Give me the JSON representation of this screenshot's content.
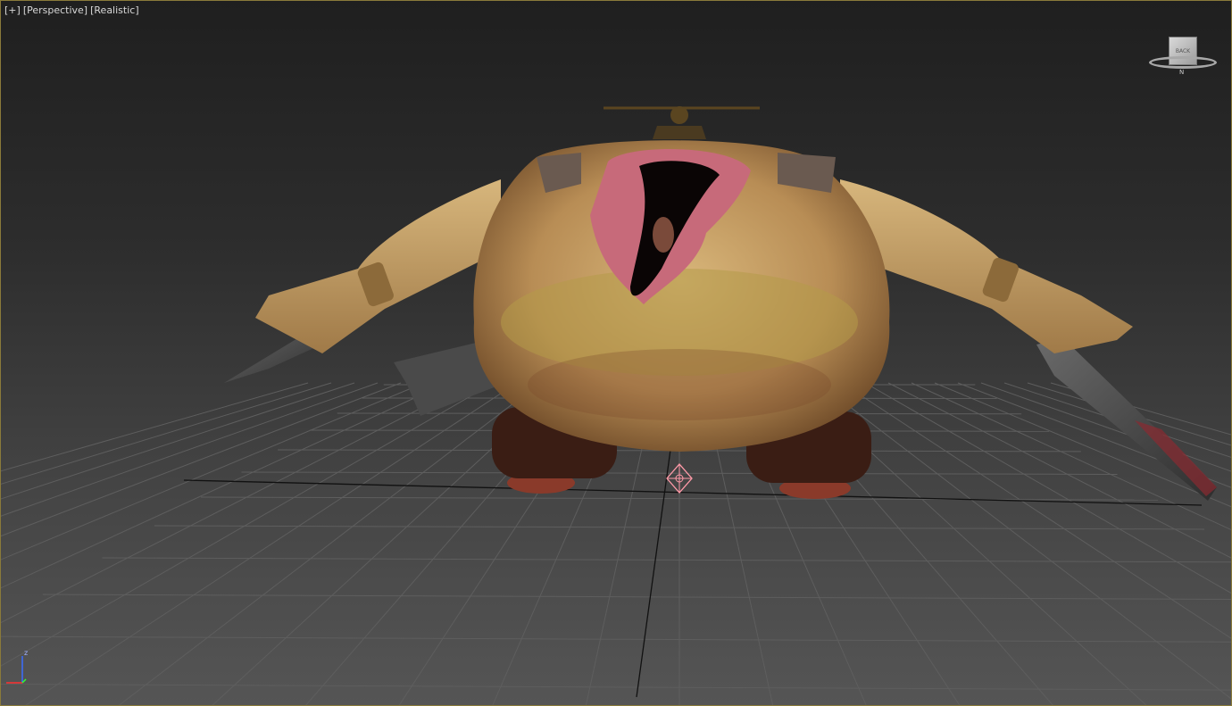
{
  "viewport": {
    "labels": [
      "[+]",
      "[Perspective]",
      "[Realistic]"
    ],
    "background_top": "#1f1f1f",
    "background_bottom": "#555555",
    "active_border_color": "#8a7a3a"
  },
  "viewcube": {
    "face_label": "BACK",
    "compass_label": "N"
  },
  "axis_tripod": {
    "z_label": "z",
    "z_color": "#3a6cff",
    "x_color": "#ff3030",
    "y_color": "#30ff30"
  },
  "model": {
    "icon": "character-model",
    "skin_color": "#c9a86a",
    "blood_color": "#b43c4a"
  },
  "pivot": {
    "icon": "pivot-gizmo-icon",
    "color": "#ff9aa8"
  }
}
